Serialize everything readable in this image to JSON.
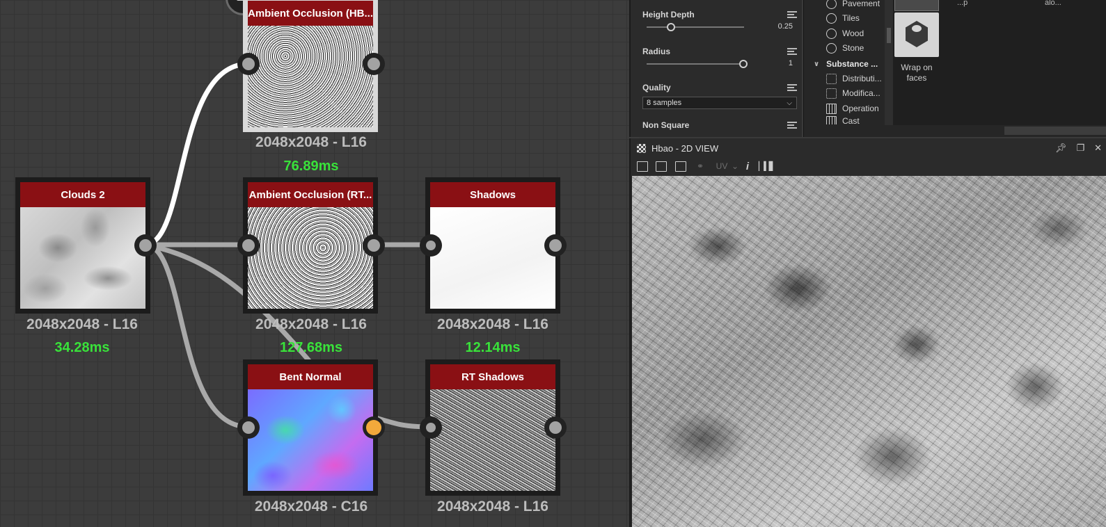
{
  "graph": {
    "nodes": {
      "ao_hbao": {
        "title": "Ambient Occlusion (HB...",
        "resolution": "2048x2048 - L16",
        "time": "76.89ms"
      },
      "clouds": {
        "title": "Clouds 2",
        "resolution": "2048x2048 - L16",
        "time": "34.28ms"
      },
      "ao_rt": {
        "title": "Ambient Occlusion (RT...",
        "resolution": "2048x2048 - L16",
        "time": "127.68ms"
      },
      "shadows": {
        "title": "Shadows",
        "resolution": "2048x2048 - L16",
        "time": "12.14ms"
      },
      "bent_normal": {
        "title": "Bent Normal",
        "resolution": "2048x2048 - C16"
      },
      "rt_shadows": {
        "title": "RT Shadows",
        "resolution": "2048x2048 - L16"
      }
    },
    "colors": {
      "node_header": "#8a1014",
      "time_text": "#39e23a",
      "active_pin": "#f2a93b"
    }
  },
  "properties": {
    "height_depth": {
      "label": "Height Depth",
      "value": "0.25",
      "fraction": 0.25
    },
    "radius": {
      "label": "Radius",
      "value": "1",
      "fraction": 1.0
    },
    "quality": {
      "label": "Quality",
      "value": "8 samples"
    },
    "non_square": {
      "label": "Non Square"
    }
  },
  "library": {
    "items": [
      "Pavement",
      "Tiles",
      "Wood",
      "Stone"
    ],
    "category": "Substance ...",
    "sub_items": [
      "Distributi...",
      "Modifica...",
      "Operation",
      "Cast"
    ],
    "tile_label_1": "Wrap on",
    "tile_label_2": "faces",
    "cut_labels": [
      "...p",
      "alo..."
    ]
  },
  "view2d": {
    "title": "Hbao - 2D VIEW",
    "uv_label": "UV",
    "info_label": "i",
    "window_icons": [
      "pin-icon",
      "restore-icon",
      "close-icon"
    ]
  }
}
